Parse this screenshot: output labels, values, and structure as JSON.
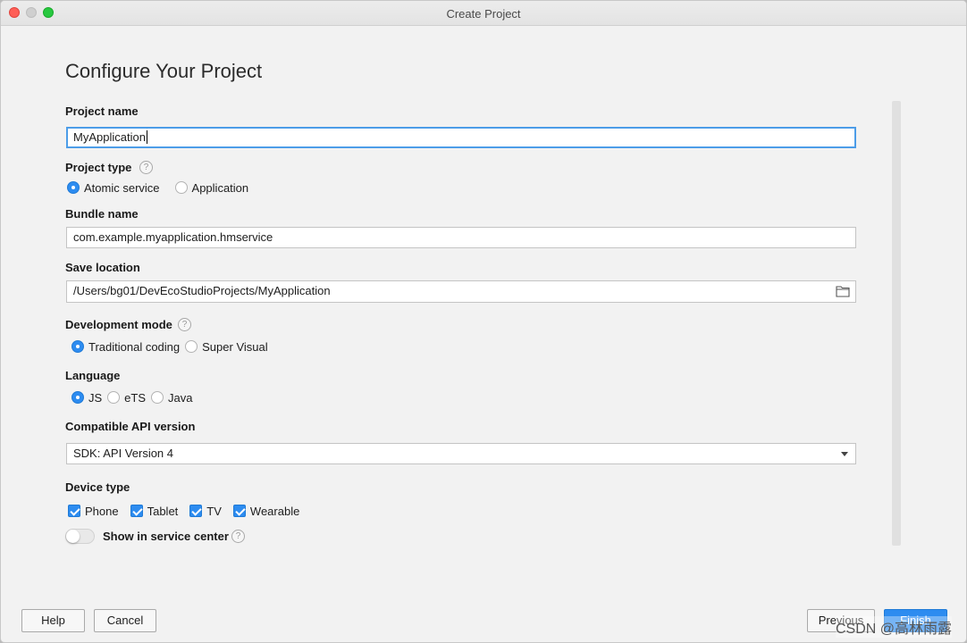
{
  "window": {
    "title": "Create Project"
  },
  "page": {
    "title": "Configure Your Project"
  },
  "project_name": {
    "label": "Project name",
    "value": "MyApplication"
  },
  "project_type": {
    "label": "Project type",
    "options": [
      {
        "label": "Atomic service",
        "selected": true
      },
      {
        "label": "Application",
        "selected": false
      }
    ]
  },
  "bundle_name": {
    "label": "Bundle name",
    "value": "com.example.myapplication.hmservice"
  },
  "save_location": {
    "label": "Save location",
    "value": "/Users/bg01/DevEcoStudioProjects/MyApplication",
    "icon": "folder-icon"
  },
  "development_mode": {
    "label": "Development mode",
    "options": [
      {
        "label": "Traditional coding",
        "selected": true
      },
      {
        "label": "Super Visual",
        "selected": false
      }
    ]
  },
  "language": {
    "label": "Language",
    "options": [
      {
        "label": "JS",
        "selected": true
      },
      {
        "label": "eTS",
        "selected": false
      },
      {
        "label": "Java",
        "selected": false
      }
    ]
  },
  "api_version": {
    "label": "Compatible API version",
    "selected": "SDK: API Version 4"
  },
  "device_type": {
    "label": "Device type",
    "options": [
      {
        "label": "Phone",
        "checked": true
      },
      {
        "label": "Tablet",
        "checked": true
      },
      {
        "label": "TV",
        "checked": true
      },
      {
        "label": "Wearable",
        "checked": true
      }
    ]
  },
  "service_center": {
    "label": "Show in service center",
    "enabled": false
  },
  "buttons": {
    "help": "Help",
    "cancel": "Cancel",
    "previous": "Previous",
    "finish": "Finish"
  },
  "watermark": "CSDN @高林雨露",
  "colors": {
    "accent": "#2d8cf0",
    "focus_ring": "#4d9de8",
    "background": "#f2f2f2"
  }
}
